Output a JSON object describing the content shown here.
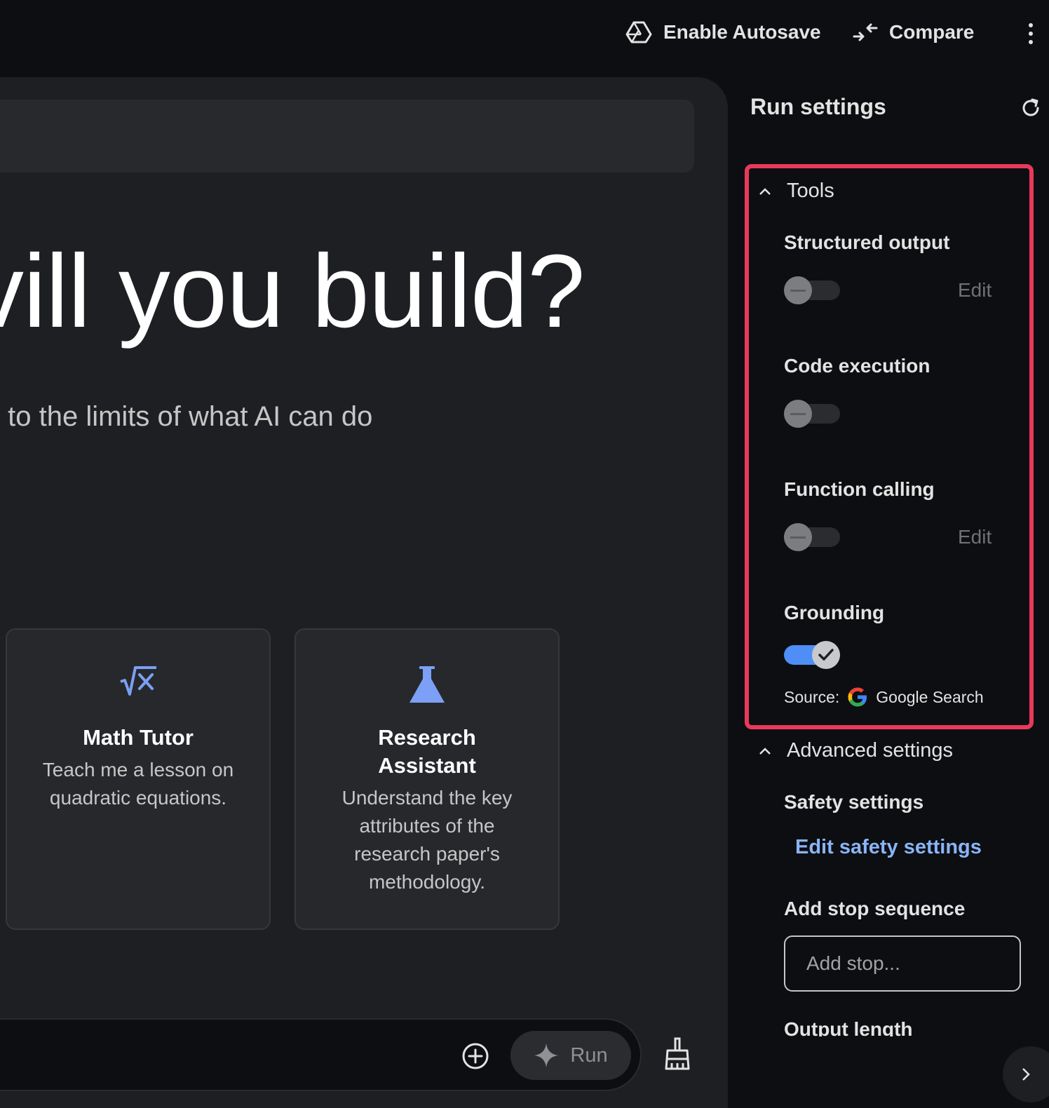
{
  "header": {
    "autosave_label": "Enable Autosave",
    "compare_label": "Compare"
  },
  "main": {
    "hero_text": "vill you build?",
    "subtitle": "ini to the limits of what AI can do",
    "cards": [
      {
        "title": "Math Tutor",
        "desc_lines": [
          "Teach me a lesson on",
          "quadratic equations."
        ]
      },
      {
        "title_lines": [
          "Research",
          "Assistant"
        ],
        "desc_lines": [
          "Understand the key",
          "attributes of the",
          "research paper's",
          "methodology."
        ]
      }
    ],
    "run_label": "Run"
  },
  "run_settings": {
    "title": "Run settings",
    "tools": {
      "header": "Tools",
      "structured_output": {
        "label": "Structured output",
        "edit": "Edit",
        "enabled": false
      },
      "code_execution": {
        "label": "Code execution",
        "enabled": false
      },
      "function_calling": {
        "label": "Function calling",
        "edit": "Edit",
        "enabled": false
      },
      "grounding": {
        "label": "Grounding",
        "enabled": true,
        "source_label": "Source:",
        "source_name": "Google Search"
      }
    },
    "advanced": {
      "header": "Advanced settings",
      "safety_label": "Safety settings",
      "safety_link": "Edit safety settings",
      "stop_label": "Add stop sequence",
      "stop_placeholder": "Add stop...",
      "output_length_label": "Output length"
    }
  },
  "colors": {
    "accent": "#8ab4f8",
    "highlight_border": "#e8395a",
    "toggle_on": "#4f8ef7",
    "card_icon": "#7ba0f5"
  }
}
